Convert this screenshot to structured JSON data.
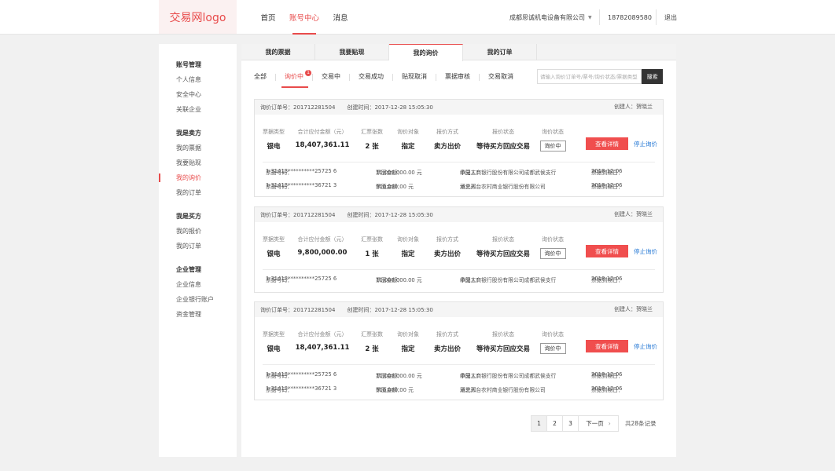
{
  "header": {
    "logo": "交易网logo",
    "nav": [
      "首页",
      "账号中心",
      "消息"
    ],
    "company": "成都思诚机电设备有限公司",
    "phone": "18782089580",
    "logout": "退出"
  },
  "sidebar": {
    "groups": [
      {
        "title": "账号管理",
        "items": [
          "个人信息",
          "安全中心",
          "关联企业"
        ]
      },
      {
        "title": "我是卖方",
        "items": [
          "我的票据",
          "我要贴现",
          "我的询价",
          "我的订单"
        ]
      },
      {
        "title": "我是买方",
        "items": [
          "我的报价",
          "我的订单"
        ]
      },
      {
        "title": "企业管理",
        "items": [
          "企业信息",
          "企业银行账户",
          "资金管理"
        ]
      }
    ],
    "active_item": "我的询价"
  },
  "tabs": [
    "我的票据",
    "我要贴现",
    "我的询价",
    "我的订单"
  ],
  "filters": [
    "全部",
    "询价中",
    "交易中",
    "交易成功",
    "贴现取消",
    "票据审核",
    "交易取消"
  ],
  "filter_badge": "1",
  "search": {
    "placeholder": "请输入询价订单号/票号/询价状态/票据类型",
    "button": "搜索"
  },
  "labels": {
    "order_no": "询价订单号：",
    "created_time": "创建时间：",
    "creator": "创建人：",
    "bill_type": "票据类型",
    "total_amount": "合计应付金额（元）",
    "bill_count": "汇票张数",
    "inquiry_target": "询价对象",
    "quote_method": "报价方式",
    "quote_status": "报价状态",
    "inquiry_status": "询价状态",
    "bill_no": "票据号码：",
    "face_amount": "票面金额：",
    "acceptor": "承兑人：",
    "due_date": "票据到期日："
  },
  "orders": [
    {
      "order_no": "201712281504",
      "created_time": "2017-12-28  15:05:30",
      "creator": "贺晓兰",
      "bill_type": "银电",
      "total_amount": "18,407,361.11",
      "bill_count": "2 张",
      "inquiry_target": "指定",
      "quote_method": "卖方出价",
      "quote_status": "等待买方回应交易",
      "inquiry_status": "询价中",
      "detail_button": "查看详情",
      "stop_link": "停止询价",
      "bills": [
        {
          "bill_no": "1 31413**********25725 6",
          "face_amount": "10,000,000.00  元",
          "acceptor": "中国工商银行股份有限公司成都武侯支行",
          "due_date": "2018-12-06"
        },
        {
          "bill_no": "1 31413**********36721 3",
          "face_amount": "900,000.00  元",
          "acceptor": "河北邢台农村商业银行股份有限公司",
          "due_date": "2018-12-06"
        }
      ]
    },
    {
      "order_no": "201712281504",
      "created_time": "2017-12-28  15:05:30",
      "creator": "贺晓兰",
      "bill_type": "银电",
      "total_amount": "9,800,000.00",
      "bill_count": "1 张",
      "inquiry_target": "指定",
      "quote_method": "卖方出价",
      "quote_status": "等待买方回应交易",
      "inquiry_status": "询价中",
      "detail_button": "查看详情",
      "stop_link": "停止询价",
      "bills": [
        {
          "bill_no": "1 31413**********25725 6",
          "face_amount": "10,000,000.00  元",
          "acceptor": "中国工商银行股份有限公司成都武侯支行",
          "due_date": "2018-12-06"
        }
      ]
    },
    {
      "order_no": "201712281504",
      "created_time": "2017-12-28  15:05:30",
      "creator": "贺晓兰",
      "bill_type": "银电",
      "total_amount": "18,407,361.11",
      "bill_count": "2 张",
      "inquiry_target": "指定",
      "quote_method": "卖方出价",
      "quote_status": "等待买方回应交易",
      "inquiry_status": "询价中",
      "detail_button": "查看详情",
      "stop_link": "停止询价",
      "bills": [
        {
          "bill_no": "1 31413**********25725 6",
          "face_amount": "10,000,000.00  元",
          "acceptor": "中国工商银行股份有限公司成都武侯支行",
          "due_date": "2018-12-06"
        },
        {
          "bill_no": "1 31413**********36721 3",
          "face_amount": "900,000.00  元",
          "acceptor": "河北邢台农村商业银行股份有限公司",
          "due_date": "2018-12-06"
        }
      ]
    }
  ],
  "pagination": {
    "pages": [
      "1",
      "2",
      "3"
    ],
    "current": "1",
    "next": "下一页",
    "total": "共28条记录"
  },
  "colors": {
    "accent": "#e84b4b",
    "link": "#2a7bd6",
    "button": "#f04e4e"
  }
}
